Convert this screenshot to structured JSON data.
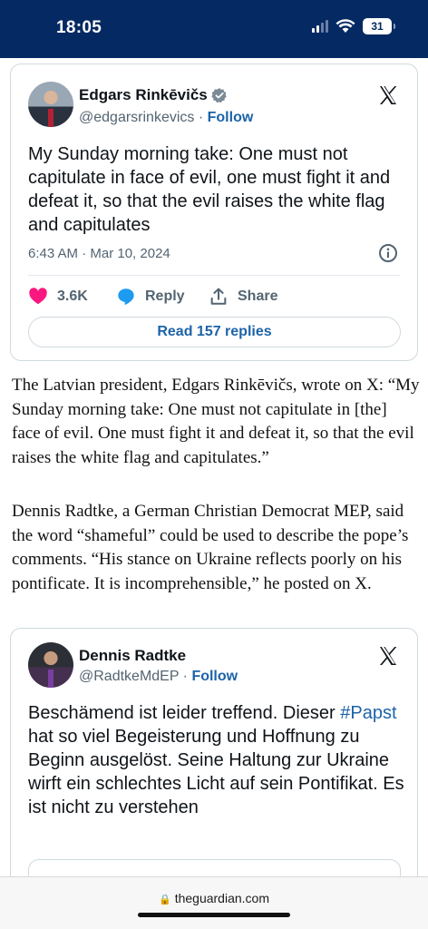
{
  "status": {
    "time": "18:05",
    "battery": "31"
  },
  "tweets": [
    {
      "name": "Edgars Rinkēvičs",
      "handle": "@edgarsrinkevics",
      "separator": " · ",
      "follow": "Follow",
      "text": "My Sunday morning take: One must not capitulate in face of evil, one must fight it and defeat it, so that the evil raises the white flag and capitulates",
      "timestamp": "6:43 AM · Mar 10, 2024",
      "likes": "3.6K",
      "reply_label": "Reply",
      "share_label": "Share",
      "read_replies": "Read 157 replies"
    },
    {
      "name": "Dennis Radtke",
      "handle": "@RadtkeMdEP",
      "separator": " · ",
      "follow": "Follow",
      "text_before": "Beschämend ist leider treffend. Dieser ",
      "hashtag": "#Papst",
      "text_after": " hat so viel Begeisterung und Hoffnung zu Beginn ausgelöst. Seine Haltung zur Ukraine wirft ein schlechtes Licht auf sein Pontifikat. Es ist nicht zu verstehen"
    }
  ],
  "article": {
    "paragraphs": [
      "The Latvian president, Edgars Rinkēvičs, wrote on X: “My Sunday morning take: One must not capitulate in [the] face of evil. One must fight it and defeat it, so that the evil raises the white flag and capitulates.”",
      "Dennis Radtke, a German Christian Democrat MEP, said the word “shameful” could be used to describe the pope’s comments. “His stance on Ukraine reflects poorly on his pontificate. It is incomprehensible,” he posted on X."
    ]
  },
  "browser": {
    "url": "theguardian.com"
  },
  "colors": {
    "status_bar": "#052962",
    "link": "#1d63a8",
    "like": "#f91880"
  },
  "icons": [
    "wifi-icon",
    "verified-icon",
    "x-logo-icon",
    "info-icon",
    "heart-icon",
    "reply-icon",
    "share-icon",
    "lock-icon"
  ]
}
